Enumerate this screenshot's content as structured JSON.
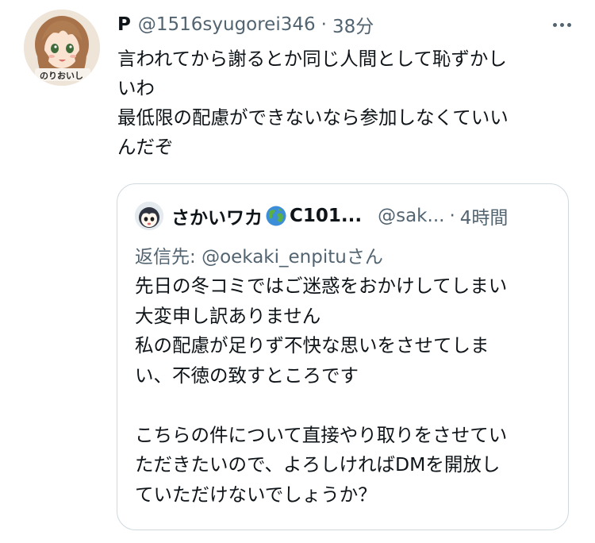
{
  "tweet": {
    "display_name": "P",
    "handle": "@1516syugorei346",
    "separator": "·",
    "time": "38分",
    "text_lines": [
      "言われてから謝るとか同じ人間として恥ずかし",
      "いわ",
      "最低限の配慮ができないなら参加しなくていい",
      "んだぞ"
    ],
    "avatar_icon": "anime-girl-avatar-icon",
    "more_icon": "more-options-icon"
  },
  "quote": {
    "display_name_prefix": "さかいワカ",
    "display_name_suffix": "C101...",
    "handle": "@sak...",
    "separator": "·",
    "time": "4時間",
    "reply_to_prefix": "返信先: ",
    "reply_to_handle": "@oekaki_enpitu",
    "reply_to_suffix": "さん",
    "text_lines": [
      "先日の冬コミではご迷惑をおかけしてしまい",
      "大変申し訳ありません",
      "私の配慮が足りず不快な思いをさせてしま",
      "い、不徳の致すところです",
      "",
      "こちらの件について直接やり取りをさせてい",
      "ただきたいので、よろしければDMを開放し",
      "ていただけないでしょうか？"
    ],
    "globe_icon": "globe-emoji-icon"
  },
  "colors": {
    "text": "#0f1419",
    "secondary": "#536471",
    "border": "#cfd9de"
  }
}
